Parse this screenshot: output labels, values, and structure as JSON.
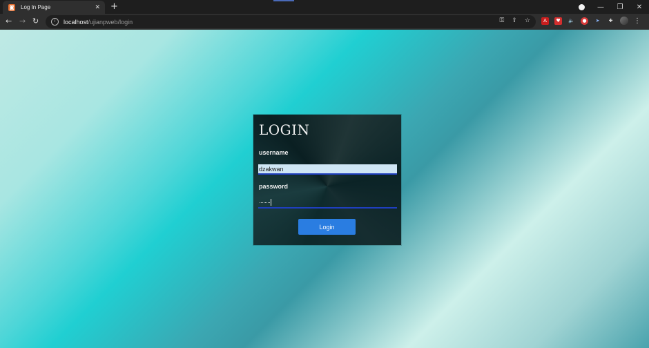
{
  "tab": {
    "title": "Log In Page",
    "favicon": "xampp-icon"
  },
  "window_controls": {
    "minimize": "—",
    "restore": "❐",
    "close": "✕"
  },
  "omnibox": {
    "host": "localhost",
    "path": "/ujianpweb/login"
  },
  "login": {
    "title": "LOGIN",
    "username_label": "username",
    "username_value": "dzakwan",
    "password_label": "password",
    "password_value": "········",
    "button_label": "Login"
  },
  "colors": {
    "button": "#2a7de1",
    "input_underline": "#1f3fbf",
    "card": "#0e2a2c"
  }
}
